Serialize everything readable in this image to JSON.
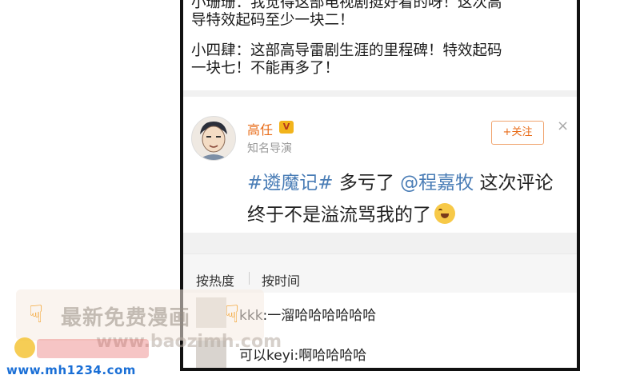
{
  "top_comments": [
    "小珊珊：我觉得这部电视剧挺好看的呀！这次高\n导特效起码至少一块二！",
    "小四肆：这部高导雷剧生涯的里程碑！特效起码\n一块七！不能再多了！"
  ],
  "post": {
    "username": "高任",
    "vip_badge": "V",
    "user_desc": "知名导演",
    "follow_label": "+关注",
    "close_symbol": "×",
    "hashtag": "#遴魔记#",
    "text_1": " 多亏了 ",
    "mention": "@程嘉牧",
    "text_2": " 这次评论\n终于不是溢流骂我的了",
    "emoji": "laugh-cry-icon"
  },
  "sort": {
    "hot_label": "按热度",
    "time_label": "按时间"
  },
  "comments": [
    {
      "text": "kkk:一溜哈哈哈哈哈哈"
    },
    {
      "text": "可以keyi:啊哈哈哈哈"
    }
  ],
  "watermark": {
    "title": "最新免费漫画",
    "url_gray": "www.baozimh.com",
    "url_blue": "www.mh1234.com",
    "hand_icon": "pointing-hand-icon"
  },
  "colors": {
    "accent": "#e86b17",
    "link": "#4a7db6",
    "watermark_blue": "#1a6fd6"
  }
}
